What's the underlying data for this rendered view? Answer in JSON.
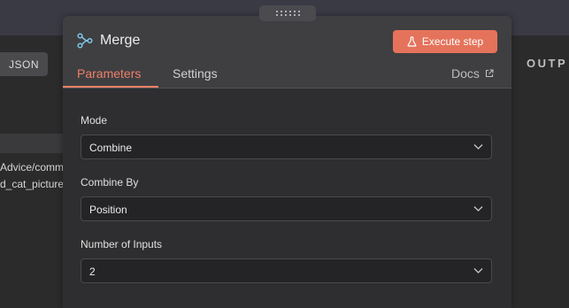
{
  "left_panel": {
    "json_tab_label": "JSON",
    "rows": [
      "Advice/comm",
      "d_cat_picture"
    ]
  },
  "output_panel": {
    "title": "OUTP"
  },
  "node": {
    "title": "Merge",
    "icon": "merge-icon",
    "execute_label": "Execute step"
  },
  "tabs": [
    {
      "label": "Parameters",
      "active": true
    },
    {
      "label": "Settings",
      "active": false
    }
  ],
  "docs_label": "Docs",
  "fields": [
    {
      "label": "Mode",
      "value": "Combine"
    },
    {
      "label": "Combine By",
      "value": "Position"
    },
    {
      "label": "Number of Inputs",
      "value": "2"
    }
  ],
  "colors": {
    "accent": "#ee8067",
    "execute_button": "#e5735b",
    "node_icon": "#7fc4e6"
  }
}
